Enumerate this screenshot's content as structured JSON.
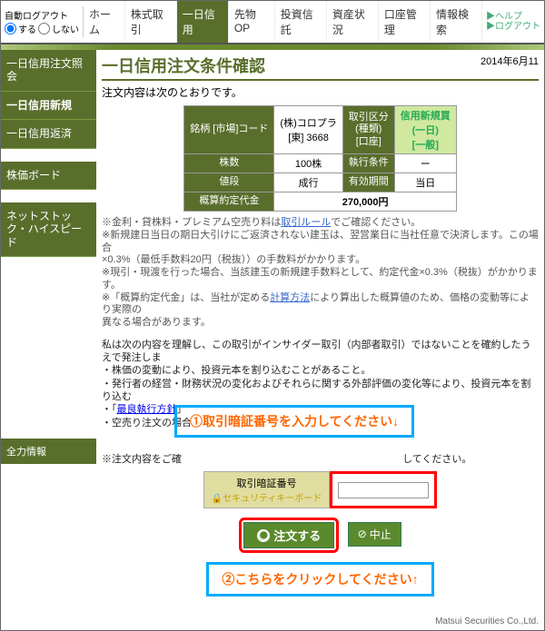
{
  "topbar": {
    "logout_label": "自動ログアウト",
    "radio_on": "する",
    "radio_off": "しない",
    "nav": [
      "ホーム",
      "株式取引",
      "一日信用",
      "先物OP",
      "投資信託",
      "資産状況",
      "口座管理",
      "情報検索"
    ],
    "active_index": 2,
    "help1": "▶ヘルプ",
    "help2": "▶ログアウト"
  },
  "sidebar": {
    "items": [
      "一日信用注文照会",
      "一日信用新規",
      "一日信用返済",
      "株価ボード",
      "ネットストック・ハイスピード"
    ],
    "active_index": 1,
    "bottom_label": "全力情報"
  },
  "page": {
    "title": "一日信用注文条件確認",
    "date": "2014年6月11",
    "intro": "注文内容は次のとおりです。"
  },
  "table": {
    "h_symbol": "銘柄\n[市場]コード",
    "h_type": "取引区分\n(種類)\n[口座]",
    "c_symbol": "(株)コロプラ\n[東] 3668",
    "c_type": "信用新規買\n(一日)\n[一般]",
    "h_qty": "株数",
    "c_qty": "100株",
    "h_cond": "執行条件",
    "c_cond": "ー",
    "h_price": "値段",
    "c_price": "成行",
    "h_valid": "有効期間",
    "c_valid": "当日",
    "h_est": "概算約定代金",
    "c_est": "270,000円"
  },
  "notes": {
    "n1": "※金利・貸株料・プレミアム空売り料は",
    "n1link": "取引ルール",
    "n1b": "でご確認ください。",
    "n2": "※新規建日当日の期日大引けにご返済されない建玉は、翌営業日に当社任意で決済します。この場合",
    "n3": "×0.3%（最低手数料20円（税抜））の手数料がかかります。",
    "n4": "※現引・現渡を行った場合、当該建玉の新規建手数料として、約定代金×0.3%（税抜）がかかります。",
    "n5a": "※「概算約定代金」は、当社が定める",
    "n5link": "計算方法",
    "n5b": "により算出した概算値のため、価格の変動等により実際の",
    "n6": "異なる場合があります。"
  },
  "para": {
    "p1": "私は次の内容を理解し、この取引がインサイダー取引（内部者取引）ではないことを確約したうえで発注しま",
    "p2": "・株価の変動により、投資元本を割り込むことがあること。",
    "p3": "・発行者の経営・財務状況の変化およびそれらに関する外部評価の変化等により、投資元本を割り込む",
    "p4a": "・「",
    "p4link": "最良執行方針",
    "p4b": "」",
    "p5": "・空売り注文の場合",
    "p6": "※注文内容をご確",
    "p6b": "してください。"
  },
  "callouts": {
    "c1": "①取引暗証番号を入力してください↓",
    "c2": "②こちらをクリックしてください↑"
  },
  "pin": {
    "label": "取引暗証番号",
    "keyboard": "🔒セキュリティキーボード"
  },
  "buttons": {
    "order": "注文する",
    "cancel": "中止"
  },
  "footer": "Matsui Securities Co.,Ltd."
}
